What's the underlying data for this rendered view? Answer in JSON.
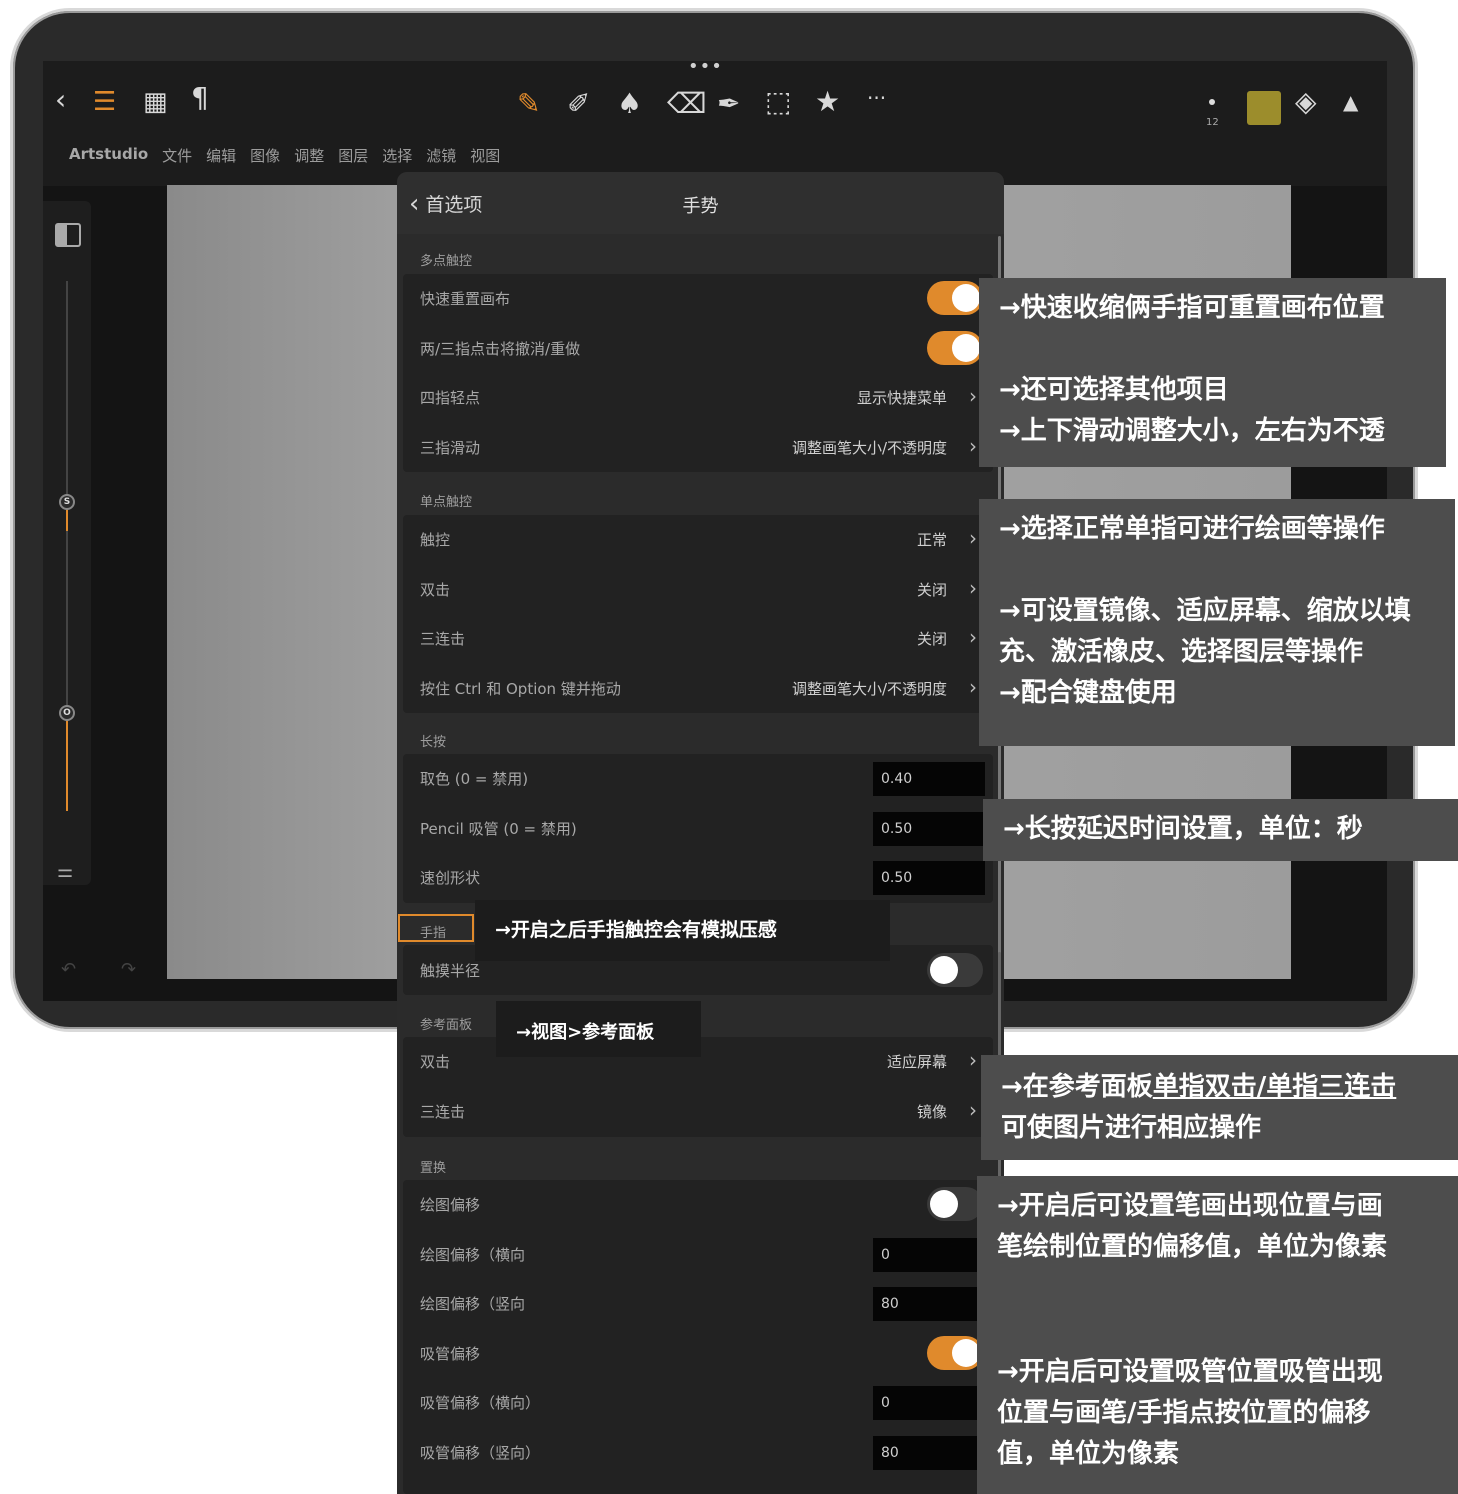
{
  "app": {
    "name": "Artstudio",
    "menus": [
      "Artstudio",
      "文件",
      "编辑",
      "图像",
      "调整",
      "图层",
      "选择",
      "滤镜",
      "视图"
    ],
    "brush_size": "12",
    "current_color": "#9c8d2c",
    "accent_color": "#e08a2c",
    "slider_s_label": "S",
    "slider_o_label": "O",
    "more_label": "•••",
    "toolbar_more_label": "···"
  },
  "sheet": {
    "back_label": "首选项",
    "title": "手势",
    "sections": {
      "multi_touch": {
        "label": "多点触控",
        "rows": [
          {
            "label": "快速重置画布",
            "toggle": true
          },
          {
            "label": "两/三指点击将撤消/重做",
            "toggle": true
          },
          {
            "label": "四指轻点",
            "value": "显示快捷菜单"
          },
          {
            "label": "三指滑动",
            "value": "调整画笔大小/不透明度"
          }
        ]
      },
      "single_touch": {
        "label": "单点触控",
        "rows": [
          {
            "label": "触控",
            "value": "正常"
          },
          {
            "label": "双击",
            "value": "关闭"
          },
          {
            "label": "三连击",
            "value": "关闭"
          },
          {
            "label": "按住 Ctrl 和 Option 键并拖动",
            "value": "调整画笔大小/不透明度"
          }
        ]
      },
      "long_press": {
        "label": "长按",
        "rows": [
          {
            "label": "取色 (0 = 禁用)",
            "input": "0.40"
          },
          {
            "label": "Pencil 吸管 (0 = 禁用)",
            "input": "0.50"
          },
          {
            "label": "速创形状",
            "input": "0.50"
          }
        ]
      },
      "finger": {
        "label": "手指",
        "rows": [
          {
            "label": "触摸半径",
            "toggle": false
          }
        ]
      },
      "reference": {
        "label": "参考面板",
        "rows": [
          {
            "label": "双击",
            "value": "适应屏幕"
          },
          {
            "label": "三连击",
            "value": "镜像"
          }
        ]
      },
      "offset": {
        "label": "置换",
        "rows": [
          {
            "label": "绘图偏移",
            "toggle": false
          },
          {
            "label": "绘图偏移（横向",
            "input": "0"
          },
          {
            "label": "绘图偏移（竖向",
            "input": "80"
          },
          {
            "label": "吸管偏移",
            "toggle": true
          },
          {
            "label": "吸管偏移（横向）",
            "input": "0"
          },
          {
            "label": "吸管偏移（竖向）",
            "input": "80"
          }
        ]
      }
    }
  },
  "annotations": {
    "a1": "→快速收缩俩手指可重置画布位置",
    "a2": "→还可选择其他项目",
    "a3": "→上下滑动调整大小，左右为不透",
    "a4": "→选择正常单指可进行绘画等操作",
    "a5_line1": "→可设置镜像、适应屏幕、缩放以填",
    "a5_line2": "充、激活橡皮、选择图层等操作",
    "a6": "→配合键盘使用",
    "a7": "→长按延迟时间设置，单位：秒",
    "a8": "→开启之后手指触控会有模拟压感",
    "a9": "→视图>参考面板",
    "a10_prefix": "→在参考面板",
    "a10_underlined": "单指双击/单指三连击",
    "a10_line2": "可使图片进行相应操作",
    "a11_line1": "→开启后可设置笔画出现位置与画",
    "a11_line2": "笔绘制位置的偏移值，单位为像素",
    "a12_line1": "→开启后可设置吸管位置吸管出现",
    "a12_line2": "位置与画笔/手指点按位置的偏移",
    "a12_line3": "值，单位为像素"
  }
}
